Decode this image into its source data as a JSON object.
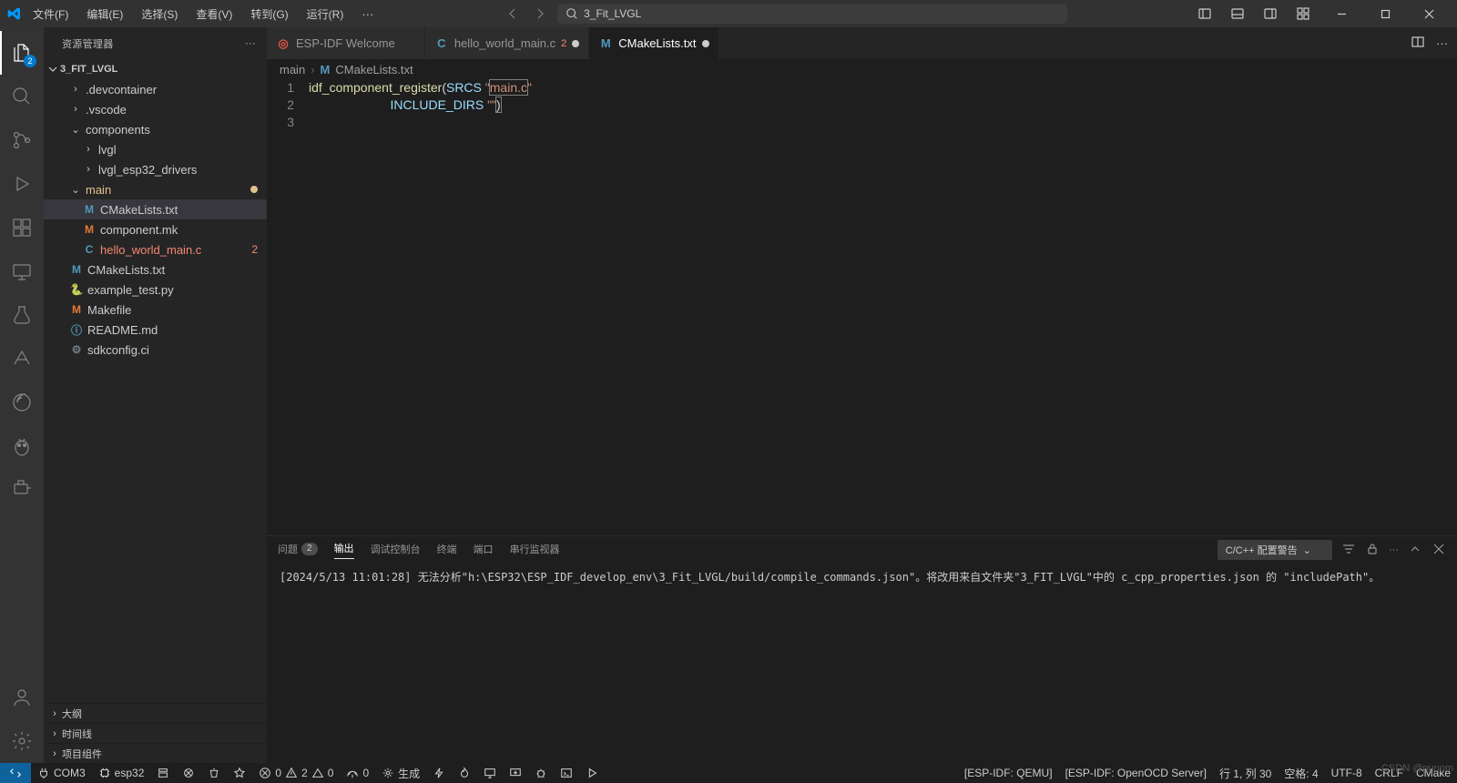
{
  "menu": {
    "file": "文件(F)",
    "edit": "编辑(E)",
    "select": "选择(S)",
    "view": "查看(V)",
    "go": "转到(G)",
    "run": "运行(R)",
    "more": "···"
  },
  "search": {
    "placeholder": "3_Fit_LVGL"
  },
  "explorer": {
    "title": "资源管理器",
    "project": "3_FIT_LVGL",
    "items": {
      "devcontainer": ".devcontainer",
      "vscode": ".vscode",
      "components": "components",
      "lvgl": "lvgl",
      "lvgl_drivers": "lvgl_esp32_drivers",
      "main": "main",
      "cmake_main": "CMakeLists.txt",
      "component_mk": "component.mk",
      "hello_world": "hello_world_main.c",
      "hello_badge": "2",
      "cmake_root": "CMakeLists.txt",
      "example_test": "example_test.py",
      "makefile": "Makefile",
      "readme": "README.md",
      "sdkconfig": "sdkconfig.ci"
    },
    "sections": {
      "outline": "大纲",
      "timeline": "时间线",
      "projectComponents": "项目组件"
    }
  },
  "activity": {
    "explorerBadge": "2"
  },
  "tabs": {
    "t1": {
      "label": "ESP-IDF Welcome"
    },
    "t2": {
      "label": "hello_world_main.c",
      "badge": "2"
    },
    "t3": {
      "label": "CMakeLists.txt"
    }
  },
  "breadcrumb": {
    "p1": "main",
    "p2": "CMakeLists.txt"
  },
  "editor": {
    "l1": {
      "num": "1",
      "fn": "idf_component_register",
      "p_open": "(",
      "srcs": "SRCS ",
      "q1": "\"",
      "str": "main.c",
      "q2": "\""
    },
    "l2": {
      "num": "2",
      "indent": "                       ",
      "incl": "INCLUDE_DIRS ",
      "q1": "\"\"",
      "p_close": ")"
    },
    "l3": {
      "num": "3"
    }
  },
  "panel": {
    "tabs": {
      "problems": "问题",
      "problemsCount": "2",
      "output": "输出",
      "debug": "调试控制台",
      "terminal": "终端",
      "ports": "端口",
      "serial": "串行监视器"
    },
    "filter": "C/C++ 配置警告",
    "log": "[2024/5/13 11:01:28] 无法分析\"h:\\ESP32\\ESP_IDF_develop_env\\3_Fit_LVGL/build/compile_commands.json\"。将改用来自文件夹\"3_FIT_LVGL\"中的 c_cpp_properties.json 的 \"includePath\"。"
  },
  "status": {
    "com": "COM3",
    "chip": "esp32",
    "errors": "0",
    "warnings": "2",
    "triangle": "0",
    "port": "0",
    "build": "生成",
    "espQemu": "[ESP-IDF: QEMU]",
    "openocd": "[ESP-IDF: OpenOCD Server]",
    "lineCol": "行 1, 列 30",
    "spaces": "空格: 4",
    "encoding": "UTF-8",
    "eol": "CRLF",
    "lang": "CMake"
  },
  "watermark": "CSDN @punnm"
}
